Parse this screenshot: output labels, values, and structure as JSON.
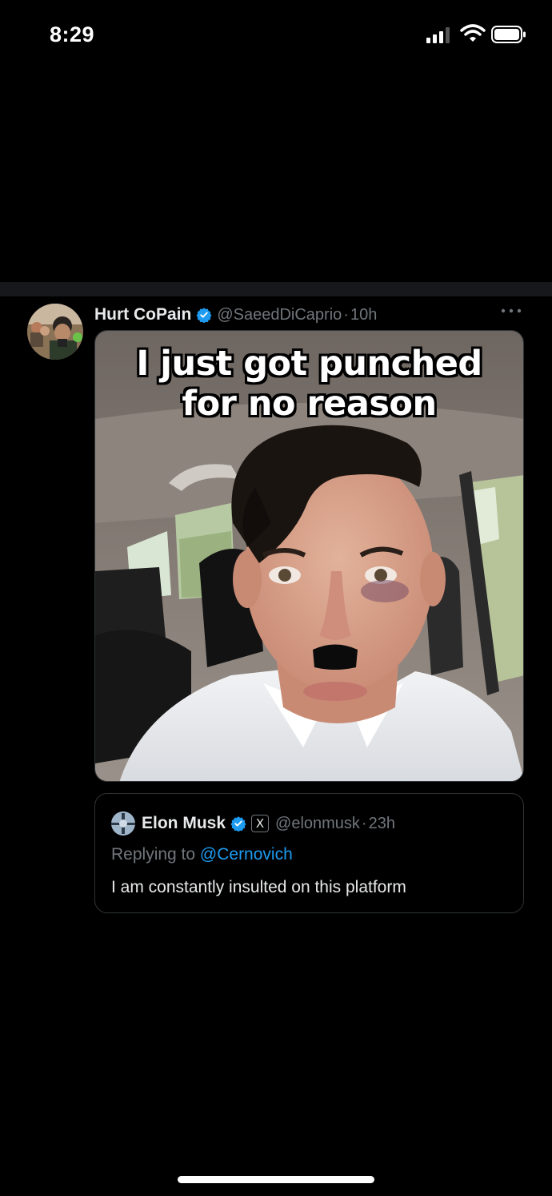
{
  "status_bar": {
    "time": "8:29",
    "icons": [
      "signal-icon",
      "wifi-icon",
      "battery-icon"
    ]
  },
  "tweet": {
    "display_name": "Hurt CoPain",
    "verified": true,
    "handle": "@SaeedDiCaprio",
    "separator": "·",
    "time": "10h",
    "more_icon": "more-icon",
    "media": {
      "caption_line1": "I just got punched",
      "caption_line2": "for no reason"
    }
  },
  "quoted_tweet": {
    "display_name": "Elon Musk",
    "verified": true,
    "affiliation_badge": "X",
    "handle": "@elonmusk",
    "separator": "·",
    "time": "23h",
    "reply_prefix": "Replying to",
    "reply_to": "@Cernovich",
    "text": "I am constantly insulted on this platform"
  },
  "colors": {
    "background": "#000000",
    "divider": "#16181c",
    "verified_blue": "#1d9bf0",
    "secondary_text": "#71767b",
    "primary_text": "#e7e9ea"
  }
}
